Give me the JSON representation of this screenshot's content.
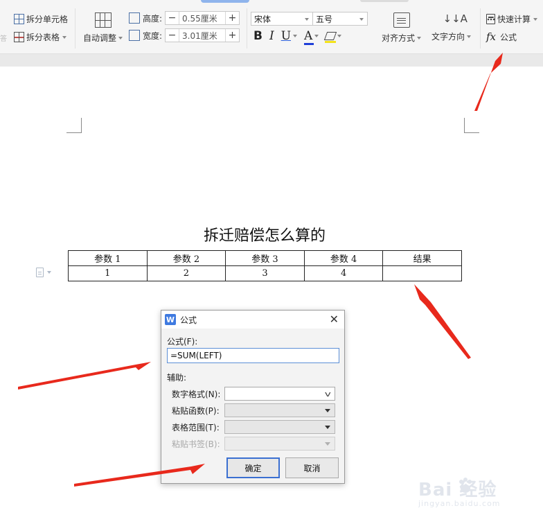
{
  "ribbon": {
    "split_cell": "拆分单元格",
    "split_table": "拆分表格",
    "auto_fit": "自动调整",
    "height_label": "高度:",
    "height_value": "0.55厘米",
    "width_label": "宽度:",
    "width_value": "3.01厘米",
    "minus": "−",
    "plus": "+",
    "font_name": "宋体",
    "font_size": "五号",
    "bold": "B",
    "italic": "I",
    "underline": "U",
    "font_color": "A",
    "font_color_hex": "#1f3fd8",
    "highlight_hex": "#f3e21a",
    "alignment": "对齐方式",
    "text_direction": "文字方向",
    "quick_calc": "快速计算",
    "fx": "fx",
    "formula": "公式",
    "partial_left": "答"
  },
  "document": {
    "title": "拆迁赔偿怎么算的",
    "table": {
      "headers": [
        "参数 1",
        "参数 2",
        "参数 3",
        "参数 4",
        "结果"
      ],
      "rows": [
        [
          "1",
          "2",
          "3",
          "4",
          ""
        ]
      ]
    }
  },
  "dialog": {
    "app_icon": "W",
    "title": "公式",
    "close": "✕",
    "formula_label": "公式(F):",
    "formula_value": "=SUM(LEFT)",
    "assist_label": "辅助:",
    "number_format_label": "数字格式(N):",
    "paste_function_label": "粘贴函数(P):",
    "table_range_label": "表格范围(T):",
    "paste_bookmark_label": "粘贴书签(B):",
    "ok": "确定",
    "cancel": "取消"
  },
  "watermark": {
    "main": "Bai  经验",
    "sub": "jingyan.baidu.com"
  },
  "colors": {
    "arrow": "#e8291c",
    "accent": "#3a6fd1"
  }
}
